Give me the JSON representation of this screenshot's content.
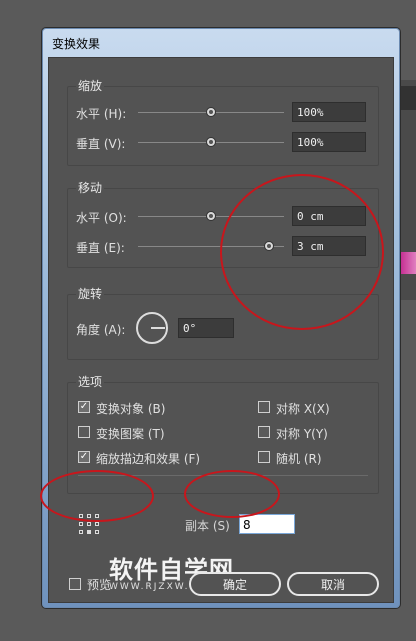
{
  "dialog": {
    "title": "变换效果"
  },
  "scale": {
    "legend": "缩放",
    "horizontal_label": "水平 (H):",
    "horizontal_value": "100%",
    "horizontal_level_pct": 50,
    "vertical_label": "垂直 (V):",
    "vertical_value": "100%",
    "vertical_level_pct": 50
  },
  "move": {
    "legend": "移动",
    "horizontal_label": "水平 (O):",
    "horizontal_value": "0 cm",
    "vertical_label": "垂直 (E):",
    "vertical_value": "3 cm"
  },
  "rotate": {
    "legend": "旋转",
    "angle_label": "角度 (A):",
    "angle_value": "0°"
  },
  "options": {
    "legend": "选项",
    "items": [
      {
        "label": "变换对象 (B)",
        "checked": true
      },
      {
        "label": "对称 X(X)",
        "checked": false
      },
      {
        "label": "变换图案 (T)",
        "checked": false
      },
      {
        "label": "对称 Y(Y)",
        "checked": false
      },
      {
        "label": "缩放描边和效果 (F)",
        "checked": true
      },
      {
        "label": "随机 (R)",
        "checked": false
      }
    ]
  },
  "copies": {
    "label": "副本 (S)",
    "value": "8"
  },
  "preview": {
    "label": "预览",
    "checked": false
  },
  "buttons": {
    "ok": "确定",
    "cancel": "取消"
  },
  "watermark": {
    "main": "软件自学网",
    "sub": "WWW.RJZXW.COM"
  },
  "colors": {
    "annotation": "#c8161c",
    "dialog_bg": "#535353"
  }
}
